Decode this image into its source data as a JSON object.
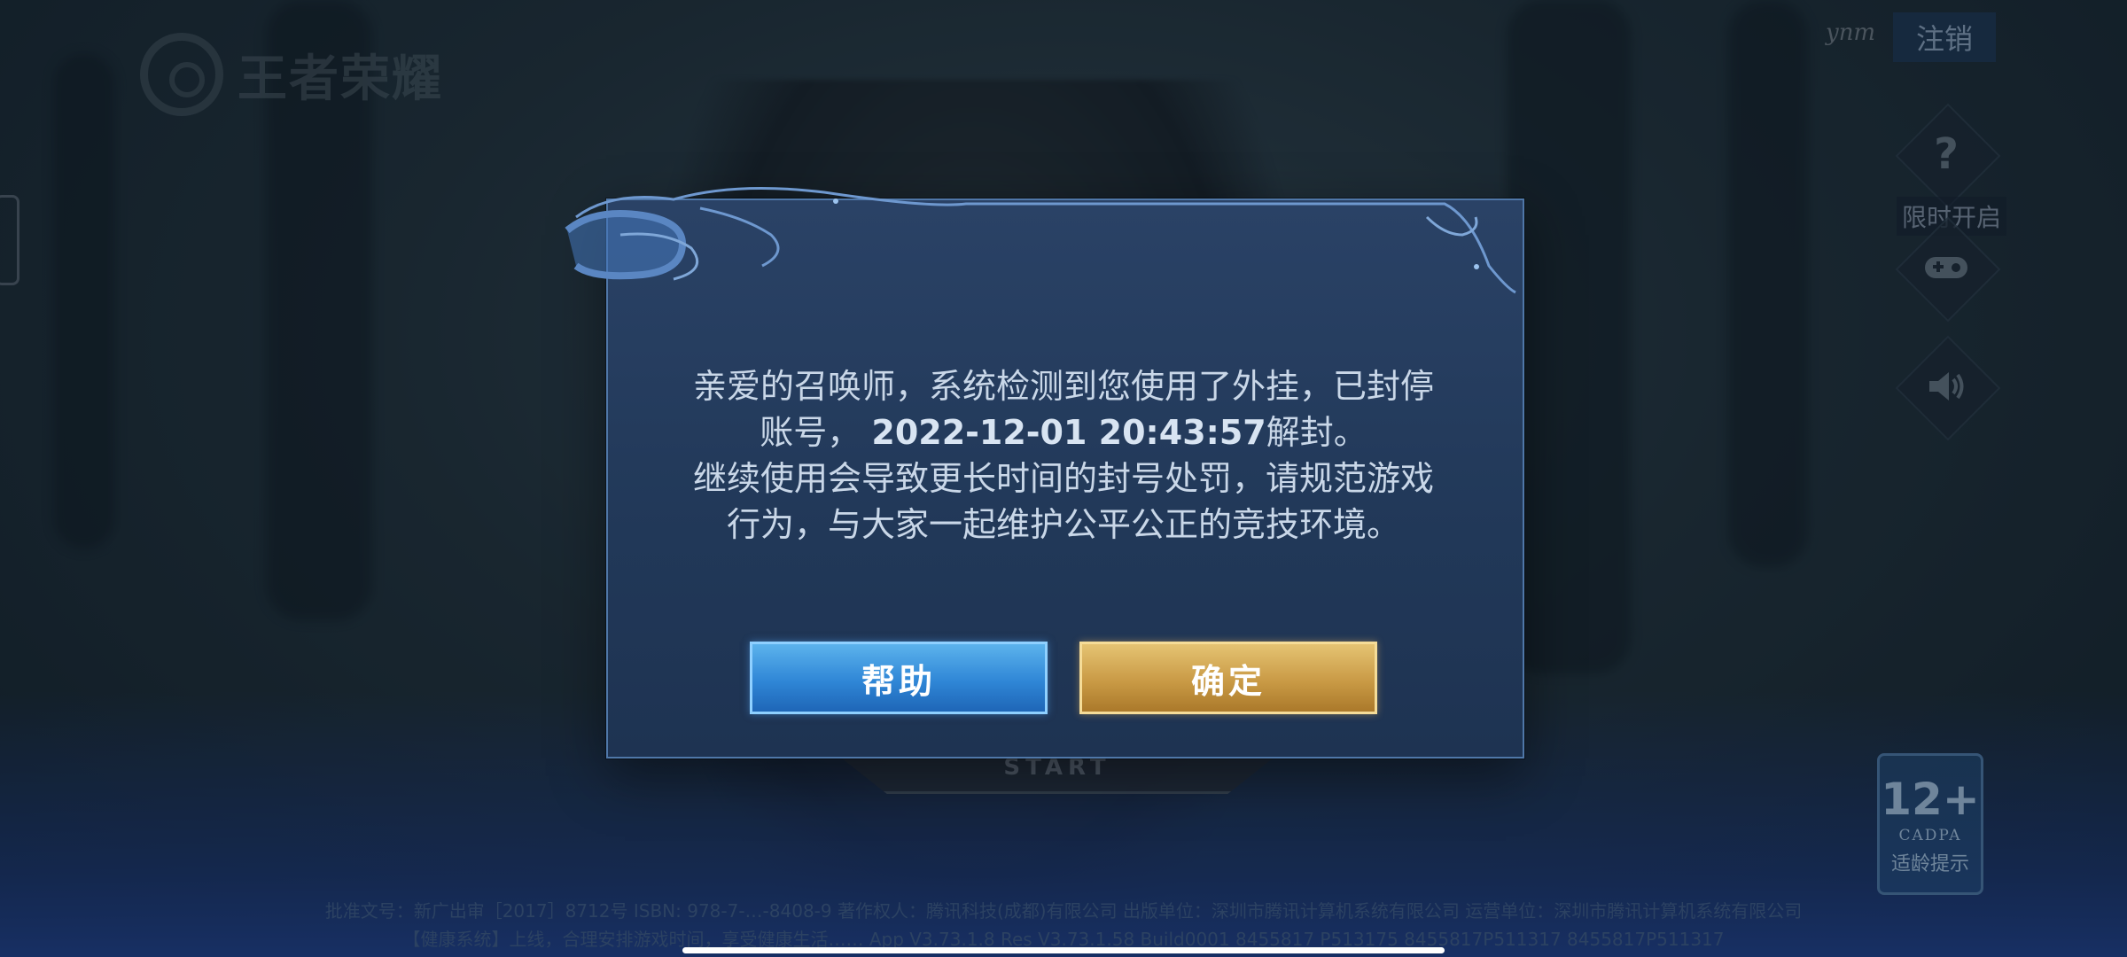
{
  "app": {
    "logo_text": "王者荣耀",
    "user_tag": "ynm",
    "logout_label": "注销",
    "start_label": "START"
  },
  "right_rail": {
    "help_icon": "question-icon",
    "limited_label": "限时开启",
    "gamepad_icon": "gamepad-icon",
    "sound_icon": "speaker-icon"
  },
  "age_badge": {
    "rating": "12+",
    "org": "CADPA",
    "note": "适龄提示"
  },
  "footer": {
    "line1": "批准文号：新广出审［2017］8712号  ISBN: 978-7-…-8408-9  著作权人：腾讯科技(成都)有限公司  出版单位：深圳市腾讯计算机系统有限公司  运营单位：深圳市腾讯计算机系统有限公司",
    "line2": "【健康系统】上线，合理安排游戏时间，享受健康生活……  App V3.73.1.8 Res V3.73.1.58 Build0001 8455817 P513175 8455817P511317 8455817P511317"
  },
  "dialog": {
    "line1": "亲爱的召唤师，系统检测到您使用了外挂，已封停",
    "line2_prefix": "账号，",
    "ban_until": "2022-12-01 20:43:57",
    "line2_suffix": "解封。",
    "line3": "继续使用会导致更长时间的封号处罚，请规范游戏",
    "line4": "行为，与大家一起维护公平公正的竞技环境。",
    "help_button": "帮助",
    "confirm_button": "确定"
  },
  "colors": {
    "help_button": "#2f86d6",
    "confirm_button": "#c99a45",
    "dialog_bg": "#243c5e"
  }
}
